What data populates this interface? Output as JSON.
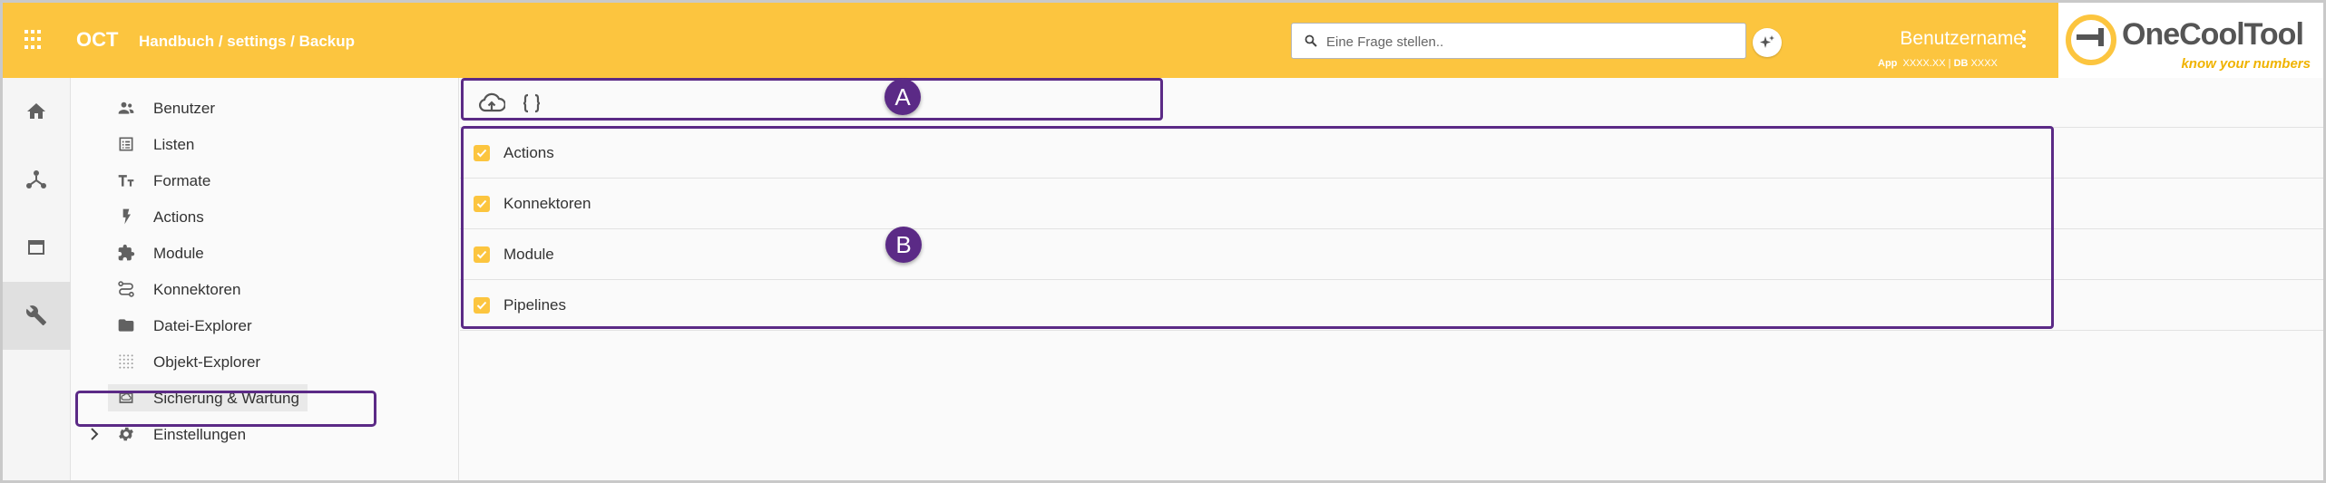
{
  "header": {
    "app_name": "OCT",
    "breadcrumb": "Handbuch / settings / Backup",
    "search_placeholder": "Eine Frage stellen..",
    "username": "Benutzername",
    "meta_app_label": "App",
    "meta_app_value": "XXXX.XX",
    "meta_sep": "|",
    "meta_db_label": "DB",
    "meta_db_value": "XXXX",
    "logo_name": "OneCoolTool",
    "logo_tagline": "know your numbers",
    "accent_color": "#fcc53f"
  },
  "rail": {
    "items": [
      {
        "icon": "home-icon"
      },
      {
        "icon": "hub-icon"
      },
      {
        "icon": "window-icon"
      },
      {
        "icon": "wrench-icon",
        "active": true
      }
    ]
  },
  "sidebar": {
    "items": [
      {
        "label": "Benutzer",
        "icon": "users-icon"
      },
      {
        "label": "Listen",
        "icon": "list-icon"
      },
      {
        "label": "Formate",
        "icon": "text-format-icon"
      },
      {
        "label": "Actions",
        "icon": "bolt-icon"
      },
      {
        "label": "Module",
        "icon": "puzzle-icon"
      },
      {
        "label": "Konnektoren",
        "icon": "route-icon"
      },
      {
        "label": "Datei-Explorer",
        "icon": "folder-icon"
      },
      {
        "label": "Objekt-Explorer",
        "icon": "dot-grid-icon"
      },
      {
        "label": "Sicherung & Wartung",
        "icon": "backup-icon",
        "selected": true
      },
      {
        "label": "Einstellungen",
        "icon": "gear-icon",
        "expandable": true
      }
    ]
  },
  "toolbar": {
    "buttons": [
      {
        "icon": "cloud-upload-icon"
      },
      {
        "icon": "braces-icon"
      }
    ]
  },
  "backup_items": [
    {
      "label": "Actions",
      "checked": true
    },
    {
      "label": "Konnektoren",
      "checked": true
    },
    {
      "label": "Module",
      "checked": true
    },
    {
      "label": "Pipelines",
      "checked": true
    }
  ],
  "annotations": {
    "marker_a": "A",
    "marker_b": "B",
    "color": "#5b2a86"
  }
}
